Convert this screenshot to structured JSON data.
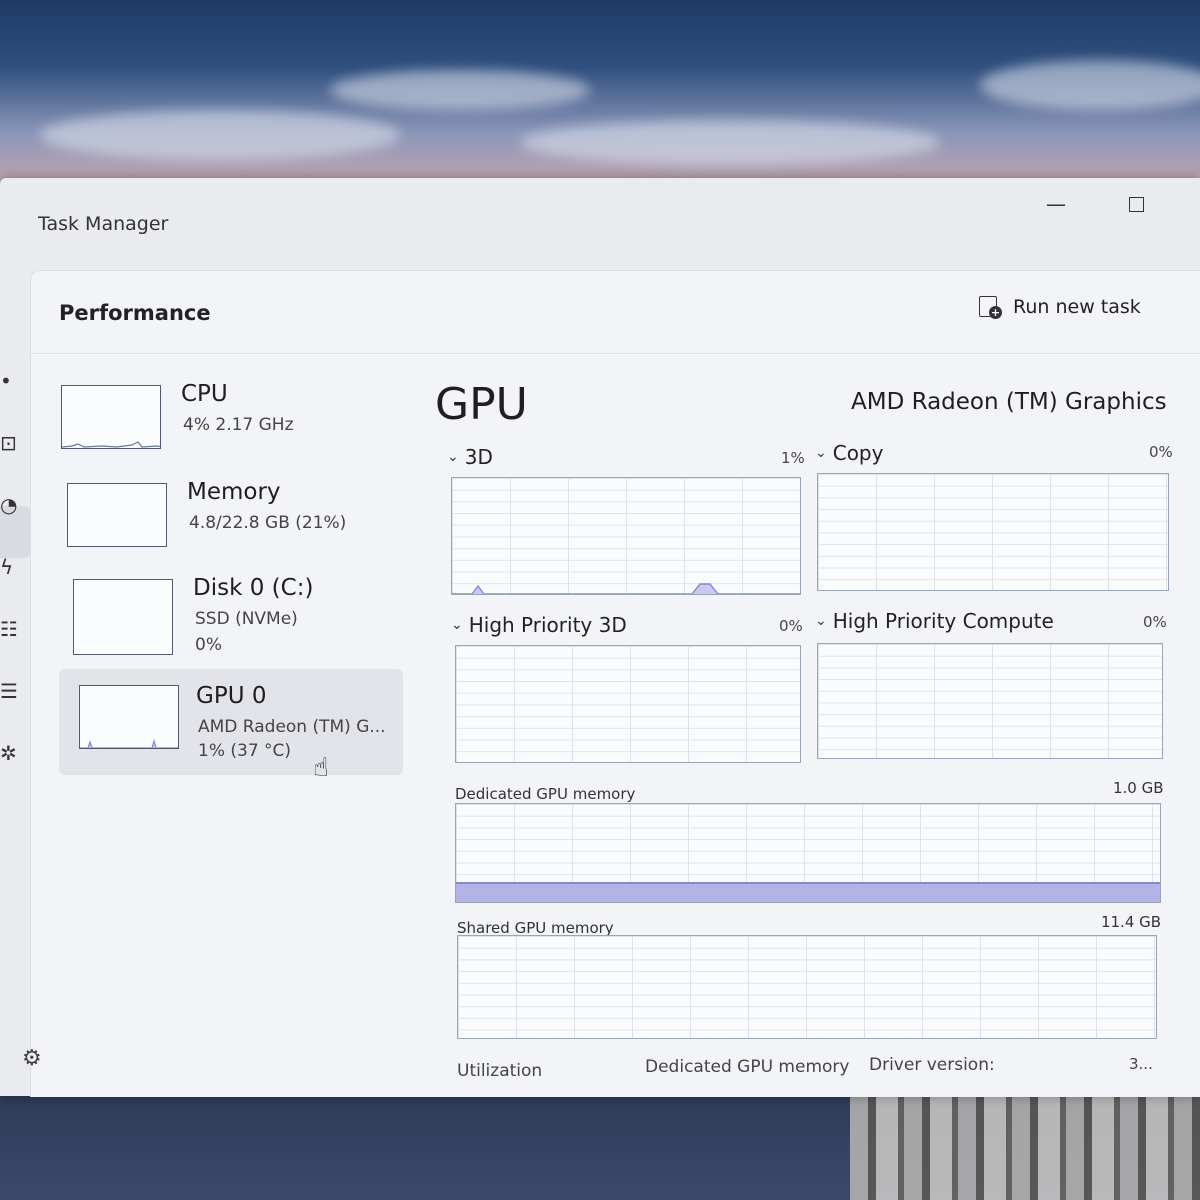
{
  "window": {
    "title": "Task Manager",
    "minimize_glyph": "—"
  },
  "header": {
    "page_title": "Performance",
    "run_new_task_label": "Run new task"
  },
  "devices": [
    {
      "name": "CPU",
      "line1": "4%  2.17 GHz",
      "line2": ""
    },
    {
      "name": "Memory",
      "line1": "4.8/22.8 GB (21%)",
      "line2": ""
    },
    {
      "name": "Disk 0 (C:)",
      "line1": "SSD (NVMe)",
      "line2": "0%"
    },
    {
      "name": "GPU 0",
      "line1": "AMD Radeon (TM) G...",
      "line2": "1%  (37 °C)"
    }
  ],
  "gpu": {
    "title": "GPU",
    "model": "AMD Radeon (TM) Graphics",
    "engines": [
      {
        "label": "3D",
        "percent": "1%"
      },
      {
        "label": "Copy",
        "percent": "0%"
      },
      {
        "label": "High Priority 3D",
        "percent": "0%"
      },
      {
        "label": "High Priority Compute",
        "percent": "0%"
      }
    ],
    "dedicated_memory": {
      "label": "Dedicated GPU memory",
      "max": "1.0 GB"
    },
    "shared_memory": {
      "label": "Shared GPU memory",
      "max": "11.4 GB"
    },
    "footer": {
      "utilization": "Utilization",
      "dedicated_memory": "Dedicated GPU memory",
      "driver_version": "Driver version:",
      "driver_value": "3..."
    }
  },
  "colors": {
    "graph_line": "#8a86d4",
    "memory_fill": "#b3b3e7",
    "window_bg": "#e9ebef"
  }
}
